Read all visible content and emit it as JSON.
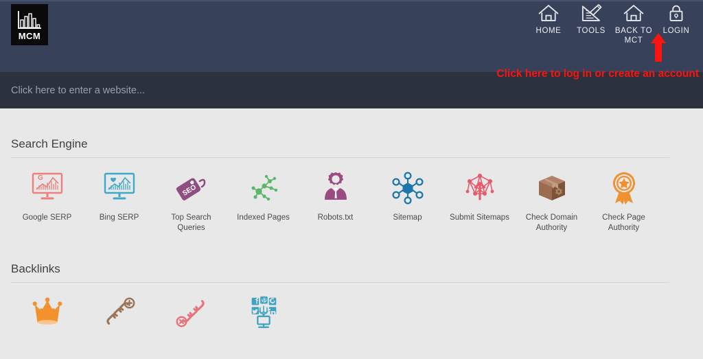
{
  "brand": {
    "name": "MCM",
    "logo_icon": "bar-chart-icon"
  },
  "nav": {
    "items": [
      {
        "label": "HOME",
        "icon": "home-icon"
      },
      {
        "label": "TOOLS",
        "icon": "ruler-pencil-icon"
      },
      {
        "label": "BACK TO MCT",
        "icon": "home-icon"
      },
      {
        "label": "LOGIN",
        "icon": "lock-icon"
      }
    ]
  },
  "annotation": {
    "text": "Click here to log in or create an account",
    "color": "#fb1410",
    "arrow_icon": "up-arrow-icon"
  },
  "search": {
    "placeholder": "Click here to enter a website...",
    "value": ""
  },
  "sections": [
    {
      "title": "Search Engine",
      "tiles": [
        {
          "label": "Google SERP",
          "icon": "monitor-google-chart-icon",
          "color": "#ef7f7a"
        },
        {
          "label": "Bing SERP",
          "icon": "monitor-bing-chart-icon",
          "color": "#3ea8c8"
        },
        {
          "label": "Top Search Queries",
          "icon": "seo-tag-icon",
          "color": "#8e4f80"
        },
        {
          "label": "Indexed Pages",
          "icon": "network-nodes-icon",
          "color": "#59b869"
        },
        {
          "label": "Robots.txt",
          "icon": "robot-person-gear-icon",
          "color": "#9c4a82"
        },
        {
          "label": "Sitemap",
          "icon": "hexagon-network-icon",
          "color": "#1d77ad"
        },
        {
          "label": "Submit Sitemaps",
          "icon": "network-upload-icon",
          "color": "#e8596b"
        },
        {
          "label": "Check Domain Authority",
          "icon": "package-box-icon",
          "color": "#8d5b3e"
        },
        {
          "label": "Check Page Authority",
          "icon": "award-rosette-icon",
          "color": "#f0912f"
        }
      ]
    },
    {
      "title": "Backlinks",
      "tiles": [
        {
          "label": "",
          "icon": "crown-icon",
          "color": "#f2912e"
        },
        {
          "label": "",
          "icon": "chain-add-icon",
          "color": "#9c7558"
        },
        {
          "label": "",
          "icon": "chain-broken-icon",
          "color": "#e8737d"
        },
        {
          "label": "",
          "icon": "social-media-monitor-icon",
          "color": "#3ea2c3"
        }
      ]
    }
  ],
  "theme": {
    "header_bg": "#37425a",
    "search_bg": "#2b323e",
    "body_bg": "#e8e8e8",
    "logo_bg": "#0a0a0a"
  }
}
